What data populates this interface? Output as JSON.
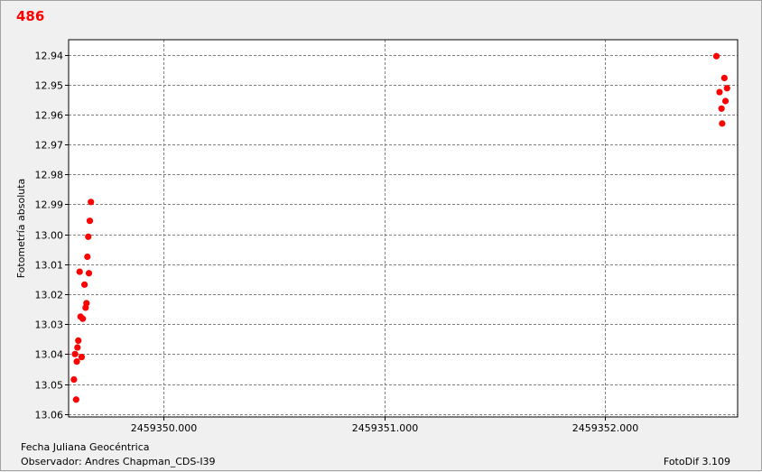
{
  "chart_data": {
    "type": "scatter",
    "title": "486",
    "ylabel": "Fotometría absoluta",
    "xlabel": "Fecha Juliana Geocéntrica",
    "observer": "Observador: Andres Chapman_CDS-I39",
    "software": "FotoDif 3.109",
    "xlim": [
      2459349.57,
      2459352.6
    ],
    "ylim": [
      12.935,
      13.061
    ],
    "y_inverted": true,
    "grid": true,
    "marker_color": "#ff0000",
    "x_ticks": [
      {
        "value": 2459350.0,
        "label": "2459350.000"
      },
      {
        "value": 2459351.0,
        "label": "2459351.000"
      },
      {
        "value": 2459352.0,
        "label": "2459352.000"
      }
    ],
    "y_ticks": [
      {
        "value": 12.94,
        "label": "12.94"
      },
      {
        "value": 12.95,
        "label": "12.95"
      },
      {
        "value": 12.96,
        "label": "12.96"
      },
      {
        "value": 12.97,
        "label": "12.97"
      },
      {
        "value": 12.98,
        "label": "12.98"
      },
      {
        "value": 12.99,
        "label": "12.99"
      },
      {
        "value": 13.0,
        "label": "13.00"
      },
      {
        "value": 13.01,
        "label": "13.01"
      },
      {
        "value": 13.02,
        "label": "13.02"
      },
      {
        "value": 13.03,
        "label": "13.03"
      },
      {
        "value": 13.04,
        "label": "13.04"
      },
      {
        "value": 13.05,
        "label": "13.05"
      },
      {
        "value": 13.06,
        "label": "13.06"
      }
    ],
    "points": [
      {
        "x": 2459349.594,
        "y": 13.0485
      },
      {
        "x": 2459349.599,
        "y": 13.04
      },
      {
        "x": 2459349.604,
        "y": 13.0552
      },
      {
        "x": 2459349.607,
        "y": 13.0425
      },
      {
        "x": 2459349.61,
        "y": 13.0378
      },
      {
        "x": 2459349.614,
        "y": 13.0355
      },
      {
        "x": 2459349.62,
        "y": 13.0125
      },
      {
        "x": 2459349.624,
        "y": 13.0275
      },
      {
        "x": 2459349.629,
        "y": 13.041
      },
      {
        "x": 2459349.634,
        "y": 13.0282
      },
      {
        "x": 2459349.642,
        "y": 13.0168
      },
      {
        "x": 2459349.647,
        "y": 13.0245
      },
      {
        "x": 2459349.651,
        "y": 13.023
      },
      {
        "x": 2459349.655,
        "y": 13.0075
      },
      {
        "x": 2459349.659,
        "y": 13.0008
      },
      {
        "x": 2459349.662,
        "y": 13.013
      },
      {
        "x": 2459349.666,
        "y": 12.9955
      },
      {
        "x": 2459349.671,
        "y": 12.9892
      },
      {
        "x": 2459352.504,
        "y": 12.9405
      },
      {
        "x": 2459352.518,
        "y": 12.9525
      },
      {
        "x": 2459352.527,
        "y": 12.958
      },
      {
        "x": 2459352.53,
        "y": 12.963
      },
      {
        "x": 2459352.54,
        "y": 12.9478
      },
      {
        "x": 2459352.545,
        "y": 12.9555
      },
      {
        "x": 2459352.552,
        "y": 12.9512
      }
    ]
  }
}
